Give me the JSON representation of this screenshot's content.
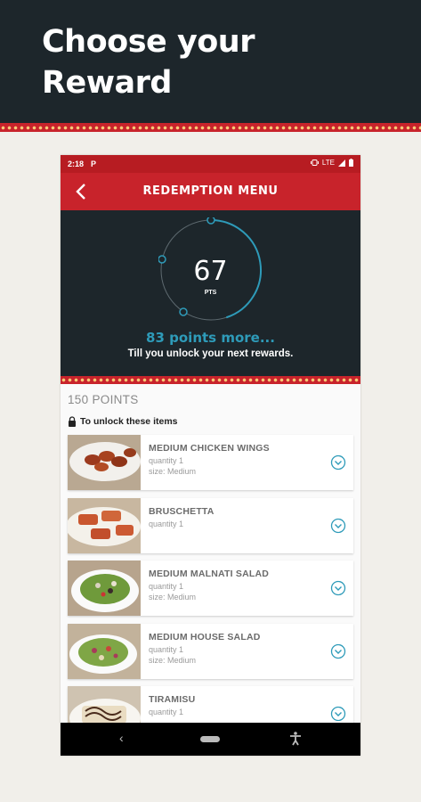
{
  "promo": {
    "title_line1": "Choose your",
    "title_line2": "Reward"
  },
  "status_bar": {
    "time": "2:18",
    "app_icon": "P",
    "network": "LTE"
  },
  "toolbar": {
    "title": "REDEMPTION MENU",
    "back_icon": "chevron-left-icon"
  },
  "points": {
    "value": "67",
    "unit": "PTS",
    "more_text": "83 points more...",
    "subtitle": "Till you unlock your next rewards.",
    "progress_fraction": 0.45
  },
  "tier": {
    "title": "150 POINTS",
    "unlock_text": "To unlock these items"
  },
  "rewards": [
    {
      "name": "MEDIUM CHICKEN WINGS",
      "quantity": "quantity 1",
      "size": "size: Medium"
    },
    {
      "name": "BRUSCHETTA",
      "quantity": "quantity 1",
      "size": ""
    },
    {
      "name": "MEDIUM MALNATI SALAD",
      "quantity": "quantity 1",
      "size": "size: Medium"
    },
    {
      "name": "MEDIUM HOUSE SALAD",
      "quantity": "quantity 1",
      "size": "size: Medium"
    },
    {
      "name": "TIRAMISU",
      "quantity": "quantity 1",
      "size": ""
    }
  ],
  "colors": {
    "brand_red": "#c8232b",
    "dark_bg": "#1d262b",
    "accent_teal": "#2e9bb9"
  }
}
